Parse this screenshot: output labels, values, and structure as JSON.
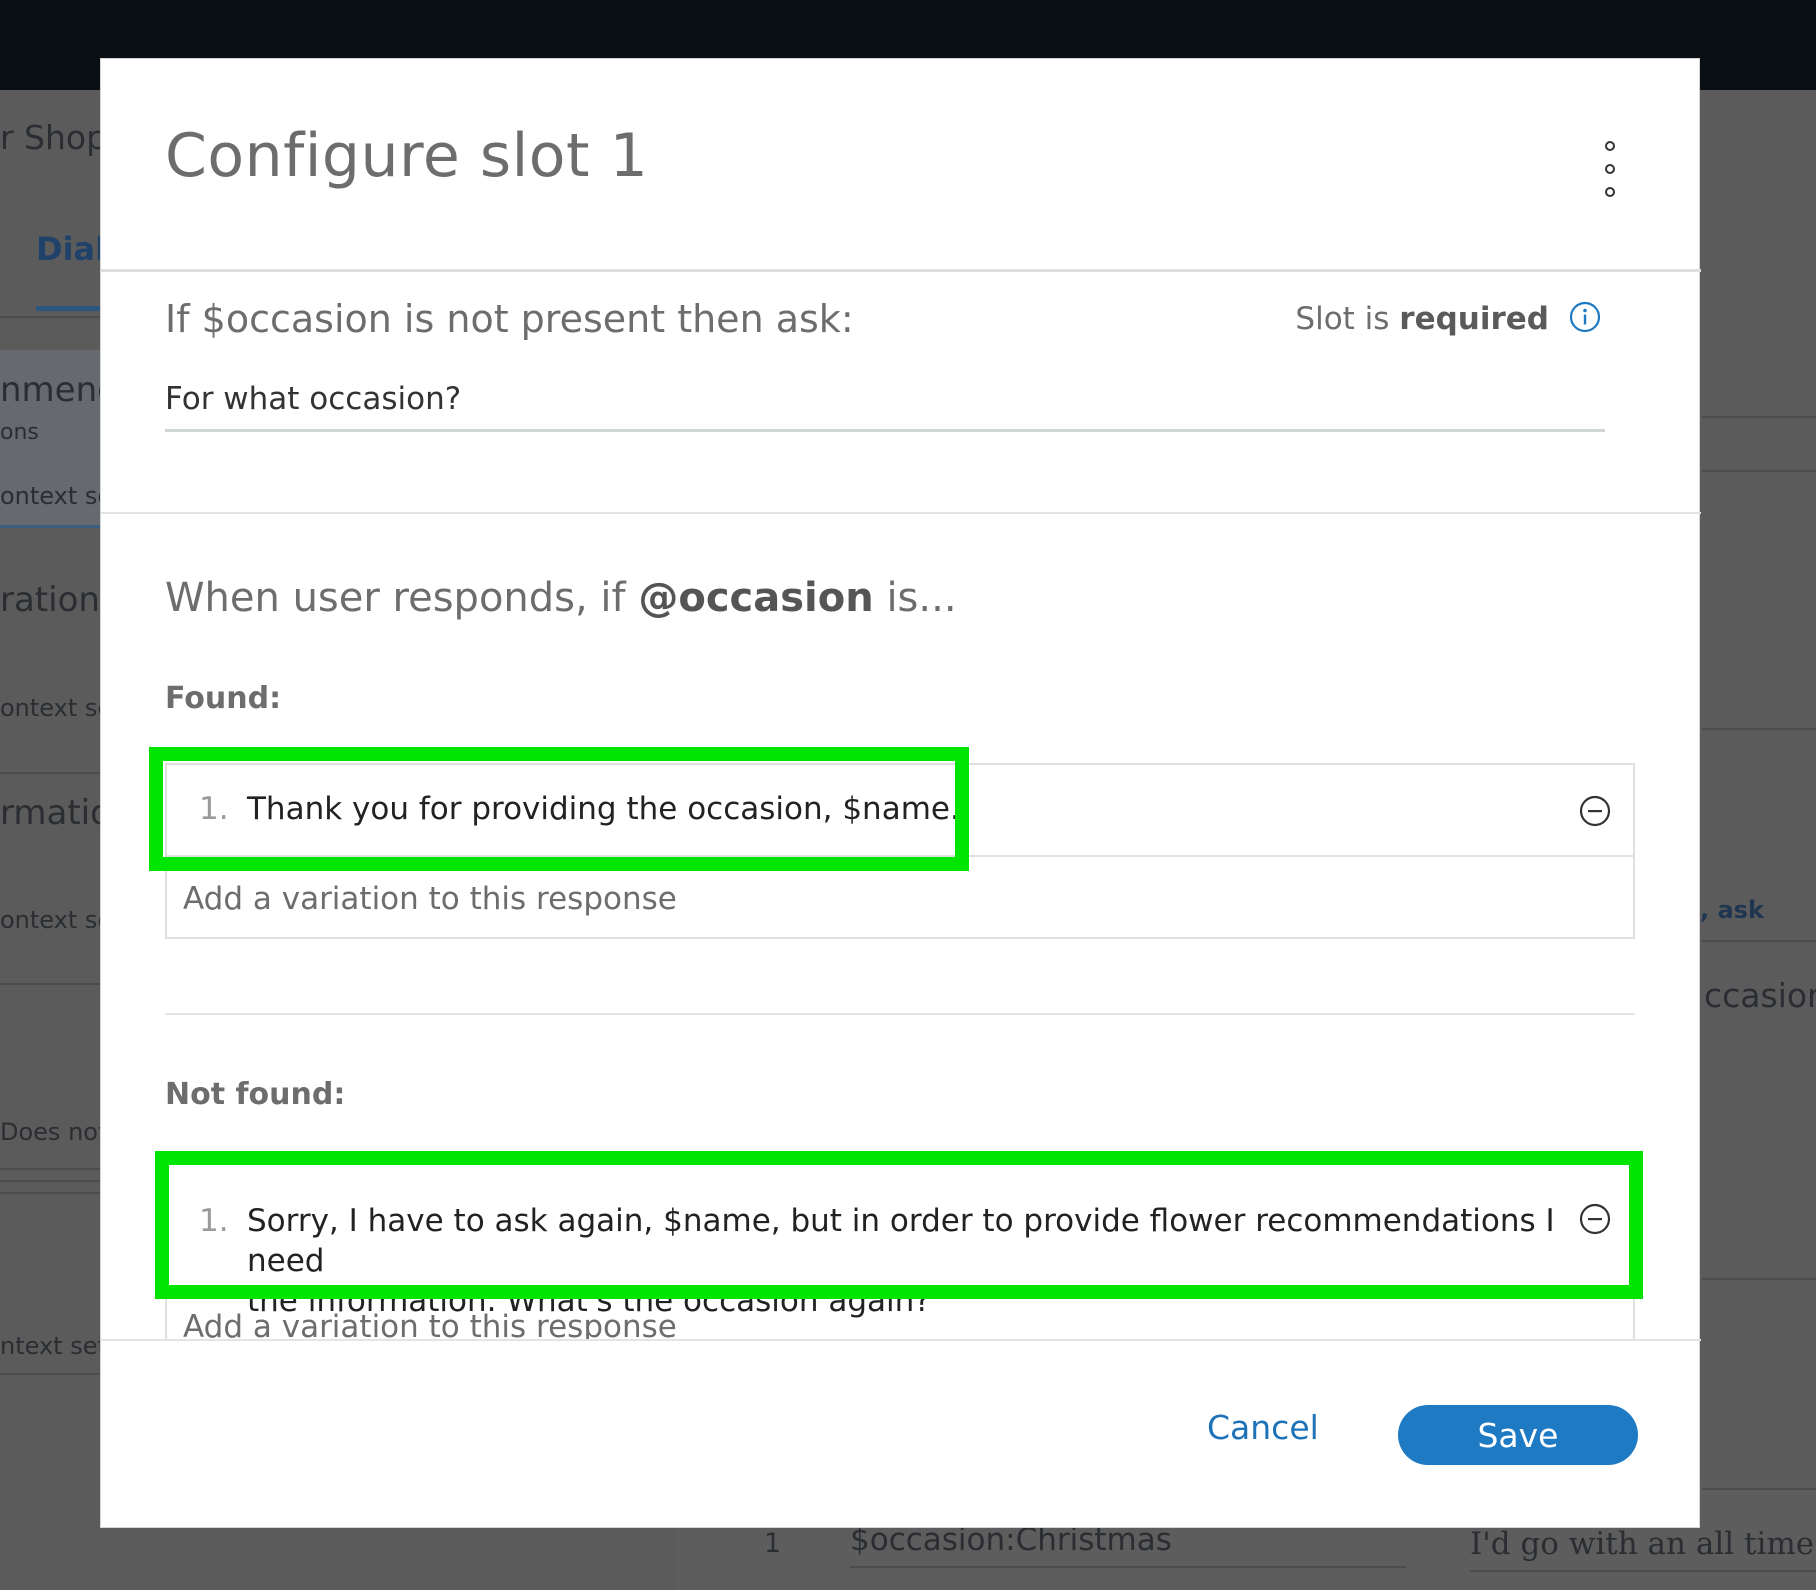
{
  "background": {
    "shop_label": "r Shop C",
    "tab_label": "Dial",
    "nodes": [
      {
        "title": "nmenda",
        "sub": "ons",
        "context": "ontext se"
      },
      {
        "title": "ration",
        "context": "ontext se"
      },
      {
        "title": "rmation",
        "context": "ontext se"
      },
      {
        "context": "Does not r"
      },
      {
        "context": "ntext set"
      }
    ],
    "right_label_ask": ", ask",
    "right_label_occasion": "ccasion",
    "row_number": "1",
    "row_value": "$occasion:Christmas",
    "row_response": "I'd go with an all time cla"
  },
  "modal": {
    "title": "Configure slot 1",
    "ask_prefix": "If $occasion is not present then ask:",
    "slot_is": "Slot is",
    "required": "required",
    "ask_value": "For what occasion?",
    "when_prefix": "When user responds, if",
    "when_entity": "@occasion",
    "when_suffix": "is...",
    "found_label": "Found:",
    "found_responses": [
      {
        "num": "1.",
        "text": "Thank you for providing the occasion, $name."
      }
    ],
    "found_variation_placeholder": "Add a variation to this response",
    "not_found_label": "Not found:",
    "not_found_responses": [
      {
        "num": "1.",
        "text_line1": "Sorry, I have to ask again, $name, but in order to provide flower recommendations I need",
        "text_line2": "the information. What's the occasion again?"
      }
    ],
    "not_found_variation_placeholder": "Add a variation to this response",
    "cancel_label": "Cancel",
    "save_label": "Save"
  },
  "colors": {
    "highlight": "#00e600",
    "primary": "#1f7ac4",
    "link": "#1e73b8"
  }
}
